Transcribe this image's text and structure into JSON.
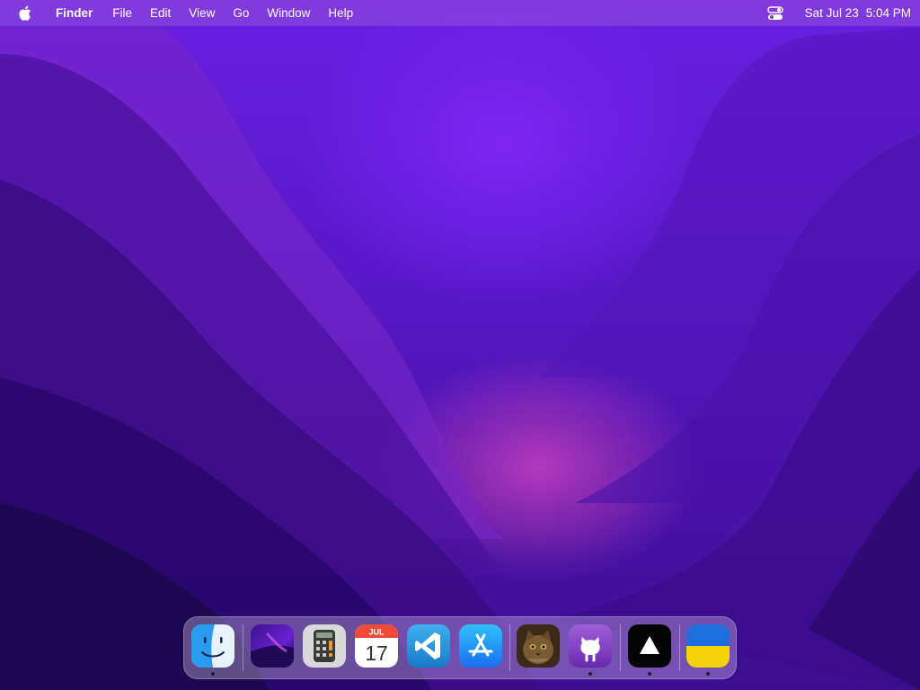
{
  "menubar": {
    "apple_icon": "apple-logo-icon",
    "app_name": "Finder",
    "menus": [
      "File",
      "Edit",
      "View",
      "Go",
      "Window",
      "Help"
    ],
    "control_center_icon": "control-center-icon",
    "date": "Sat Jul 23",
    "time": "5:04 PM"
  },
  "dock": {
    "items": [
      {
        "icon": "finder-icon",
        "running": true
      },
      {
        "icon": "monterey-wallpaper-icon",
        "running": false
      },
      {
        "icon": "calculator-icon",
        "running": false
      },
      {
        "icon": "calendar-icon",
        "running": false,
        "month": "JUL",
        "day": "17"
      },
      {
        "icon": "vscode-icon",
        "running": false
      },
      {
        "icon": "app-store-icon",
        "running": false
      },
      {
        "icon": "cat-photo-icon",
        "running": false
      },
      {
        "icon": "github-icon",
        "running": true
      },
      {
        "icon": "triangle-app-icon",
        "running": true
      },
      {
        "icon": "ukraine-flag-icon",
        "running": true
      }
    ]
  },
  "colors": {
    "wallpaper_top": "#6a1fe0",
    "wallpaper_glow": "#d646be",
    "wallpaper_dark": "#1c0850",
    "menubar": "#9650dc"
  }
}
